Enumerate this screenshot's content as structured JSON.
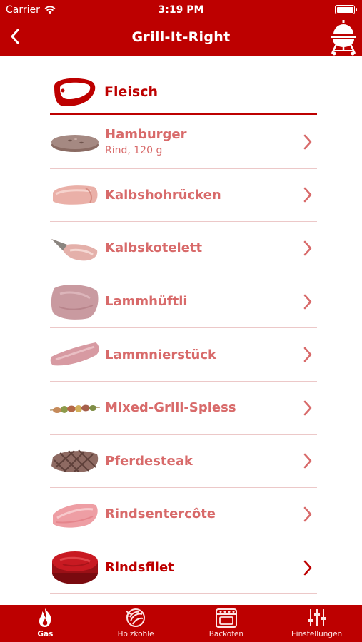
{
  "status_bar": {
    "carrier": "Carrier",
    "time": "3:19 PM"
  },
  "nav": {
    "title": "Grill-It-Right"
  },
  "section": {
    "title": "Fleisch"
  },
  "items": [
    {
      "name": "Hamburger",
      "subtitle": "Rind, 120 g"
    },
    {
      "name": "Kalbshohrücken",
      "subtitle": ""
    },
    {
      "name": "Kalbskotelett",
      "subtitle": ""
    },
    {
      "name": "Lammhüftli",
      "subtitle": ""
    },
    {
      "name": "Lammnierstück",
      "subtitle": ""
    },
    {
      "name": "Mixed-Grill-Spiess",
      "subtitle": ""
    },
    {
      "name": "Pferdesteak",
      "subtitle": ""
    },
    {
      "name": "Rindsentercôte",
      "subtitle": ""
    },
    {
      "name": "Rindsfilet",
      "subtitle": ""
    }
  ],
  "tabs": [
    {
      "label": "Gas",
      "icon": "flame-icon",
      "selected": true
    },
    {
      "label": "Holzkohle",
      "icon": "charcoal-icon",
      "selected": false
    },
    {
      "label": "Backofen",
      "icon": "oven-icon",
      "selected": false
    },
    {
      "label": "Einstellungen",
      "icon": "sliders-icon",
      "selected": false
    }
  ],
  "colors": {
    "brand_red": "#bd0000",
    "item_text": "#d86a6a",
    "divider": "#ecc8c8"
  }
}
